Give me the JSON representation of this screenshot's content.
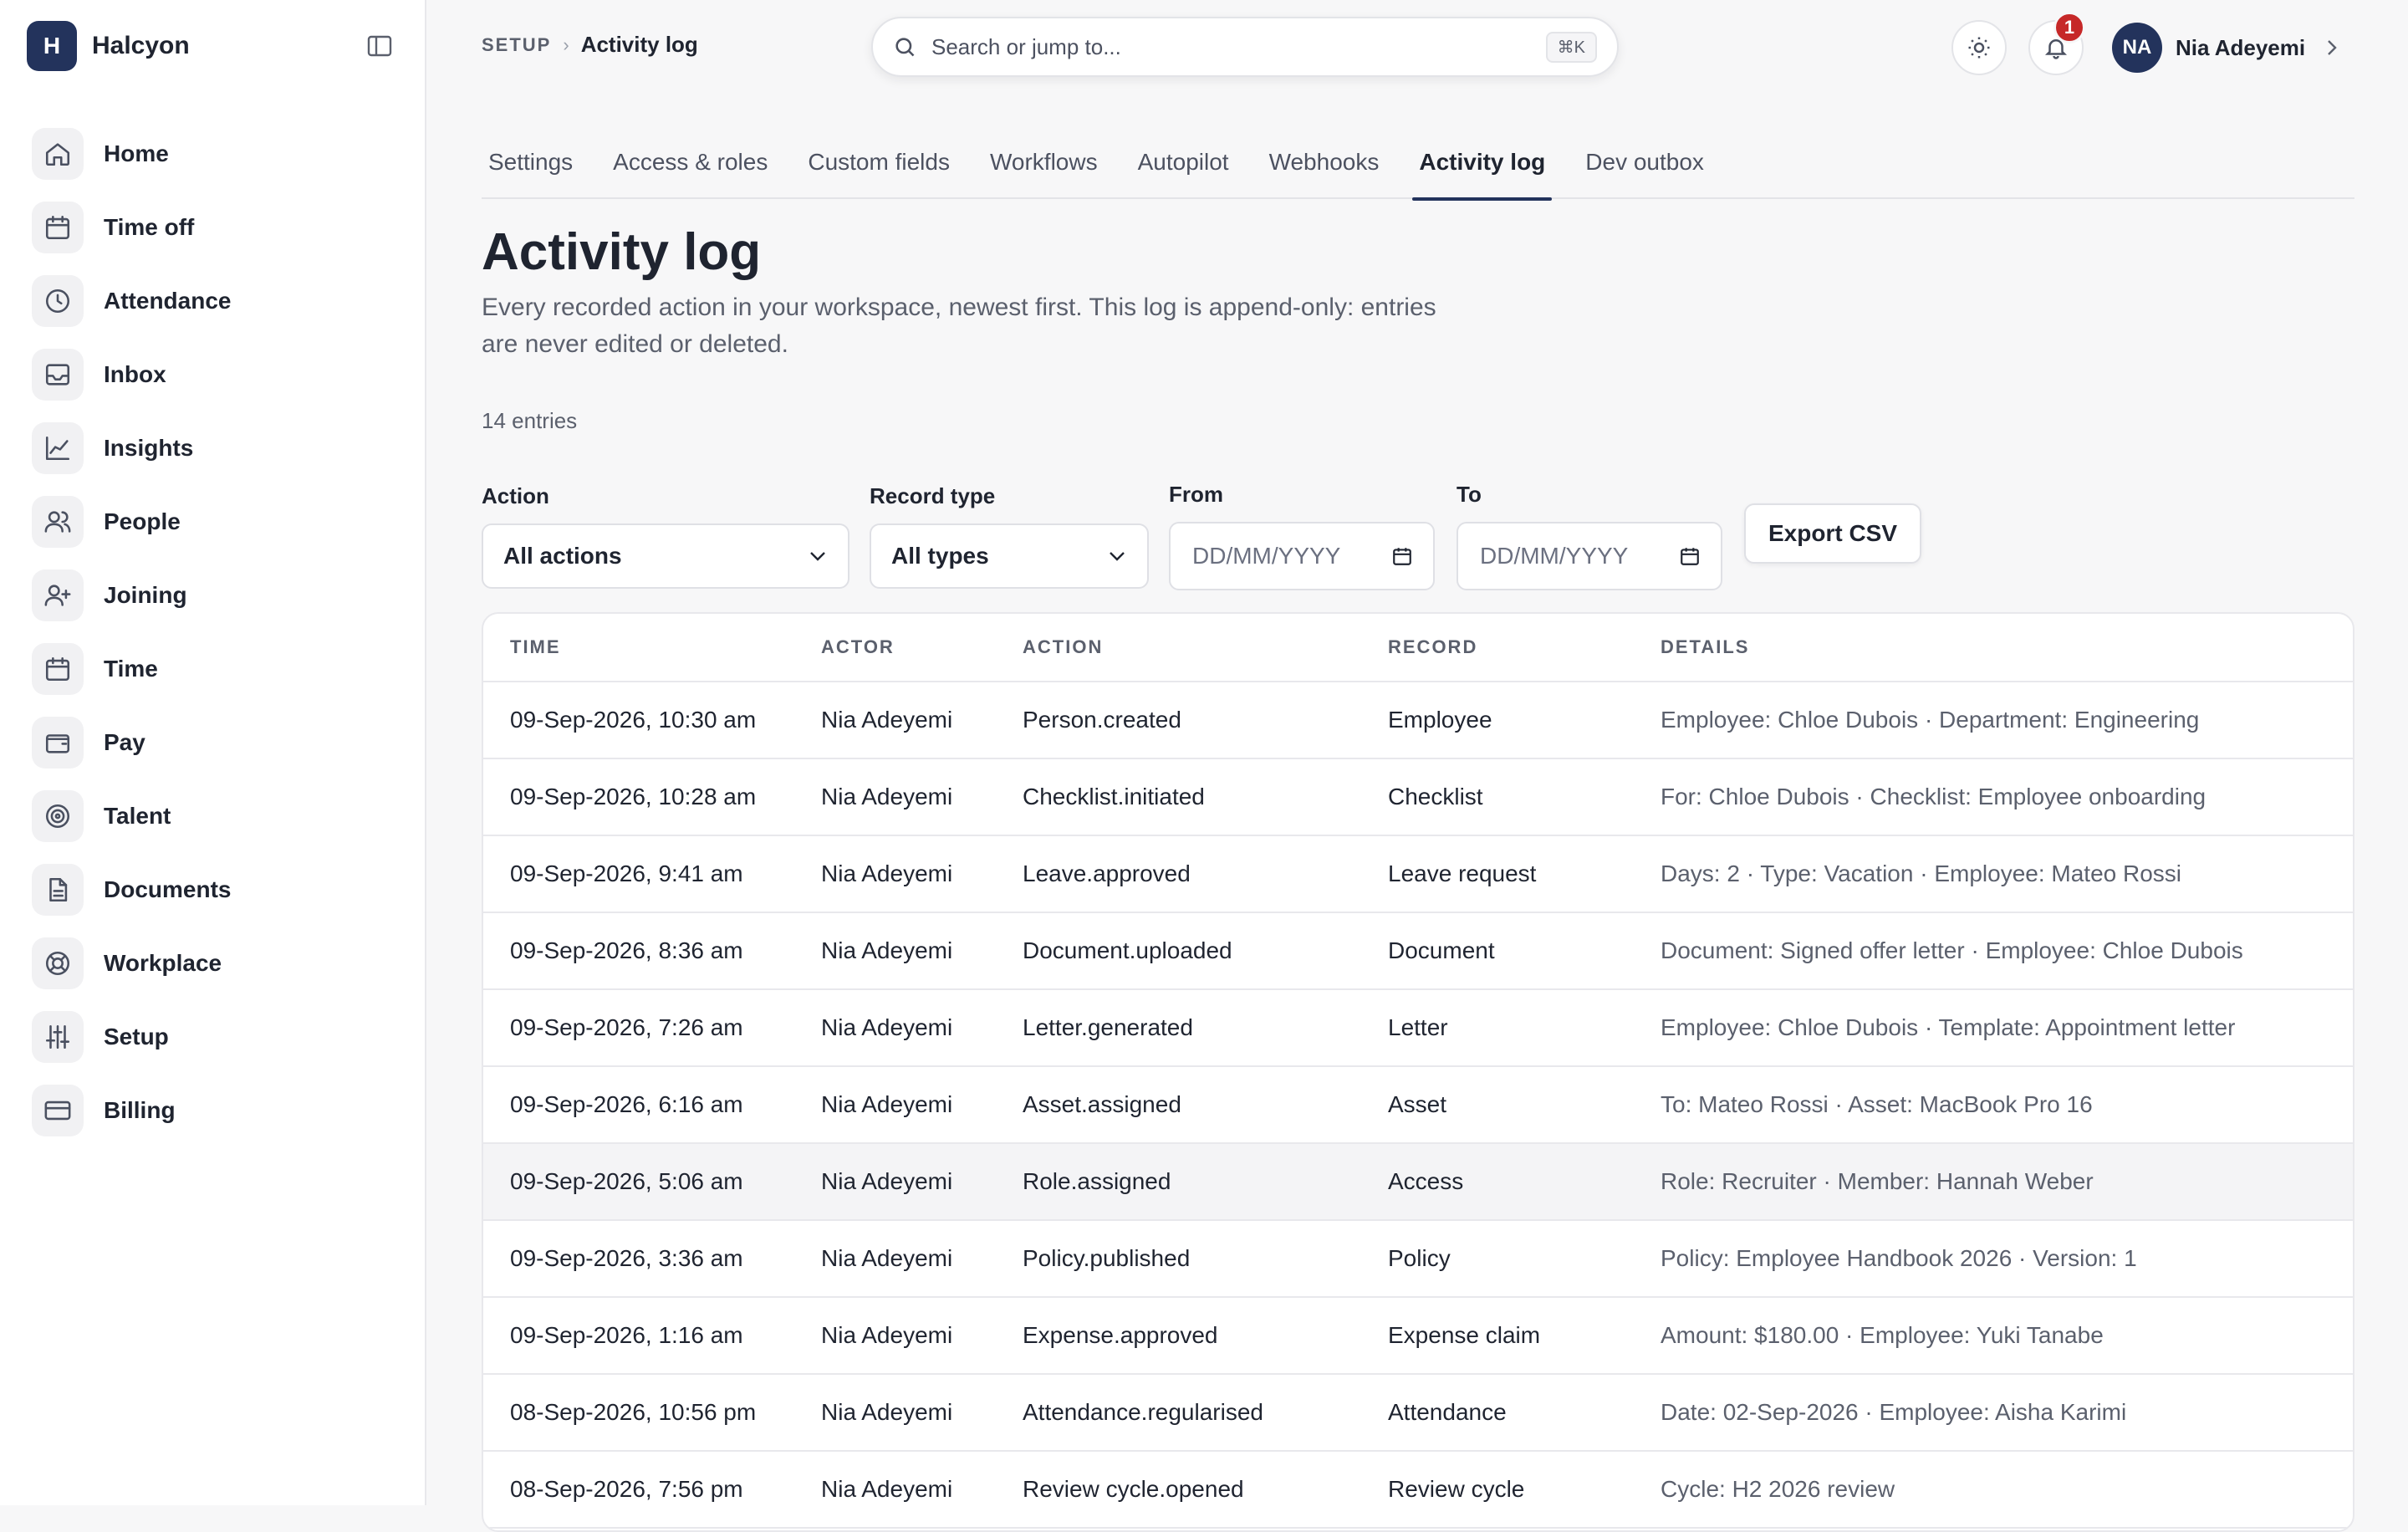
{
  "app": {
    "name": "Halcyon",
    "logo_letter": "H"
  },
  "sidebar": {
    "items": [
      {
        "label": "Home",
        "icon": "home-icon"
      },
      {
        "label": "Time off",
        "icon": "calendar-icon"
      },
      {
        "label": "Attendance",
        "icon": "clock-icon"
      },
      {
        "label": "Inbox",
        "icon": "inbox-icon"
      },
      {
        "label": "Insights",
        "icon": "chart-icon"
      },
      {
        "label": "People",
        "icon": "users-icon"
      },
      {
        "label": "Joining",
        "icon": "user-plus-icon"
      },
      {
        "label": "Time",
        "icon": "calendar-icon"
      },
      {
        "label": "Pay",
        "icon": "wallet-icon"
      },
      {
        "label": "Talent",
        "icon": "target-icon"
      },
      {
        "label": "Documents",
        "icon": "document-icon"
      },
      {
        "label": "Workplace",
        "icon": "lifebuoy-icon"
      },
      {
        "label": "Setup",
        "icon": "sliders-icon"
      },
      {
        "label": "Billing",
        "icon": "credit-card-icon"
      }
    ]
  },
  "breadcrumb": {
    "section": "SETUP",
    "current": "Activity log"
  },
  "search": {
    "placeholder": "Search or jump to...",
    "shortcut": "⌘K"
  },
  "header": {
    "notification_count": "1",
    "user_initials": "NA",
    "user_name": "Nia Adeyemi"
  },
  "tabs": [
    {
      "label": "Settings"
    },
    {
      "label": "Access & roles"
    },
    {
      "label": "Custom fields"
    },
    {
      "label": "Workflows"
    },
    {
      "label": "Autopilot"
    },
    {
      "label": "Webhooks"
    },
    {
      "label": "Activity log",
      "active": true
    },
    {
      "label": "Dev outbox"
    }
  ],
  "page": {
    "title": "Activity log",
    "subtitle": "Every recorded action in your workspace, newest first. This log is append-only: entries are never edited or deleted.",
    "entry_count": "14 entries"
  },
  "filters": {
    "action_label": "Action",
    "action_value": "All actions",
    "record_type_label": "Record type",
    "record_type_value": "All types",
    "from_label": "From",
    "from_placeholder": "DD/MM/YYYY",
    "to_label": "To",
    "to_placeholder": "DD/MM/YYYY",
    "export_label": "Export CSV"
  },
  "table": {
    "headers": {
      "time": "TIME",
      "actor": "ACTOR",
      "action": "ACTION",
      "record": "RECORD",
      "details": "DETAILS"
    },
    "rows": [
      {
        "time": "09-Sep-2026, 10:30 am",
        "actor": "Nia Adeyemi",
        "action": "Person.created",
        "record": "Employee",
        "details": "Employee: Chloe Dubois · Department: Engineering"
      },
      {
        "time": "09-Sep-2026, 10:28 am",
        "actor": "Nia Adeyemi",
        "action": "Checklist.initiated",
        "record": "Checklist",
        "details": "For: Chloe Dubois · Checklist: Employee onboarding"
      },
      {
        "time": "09-Sep-2026, 9:41 am",
        "actor": "Nia Adeyemi",
        "action": "Leave.approved",
        "record": "Leave request",
        "details": "Days: 2 · Type: Vacation · Employee: Mateo Rossi"
      },
      {
        "time": "09-Sep-2026, 8:36 am",
        "actor": "Nia Adeyemi",
        "action": "Document.uploaded",
        "record": "Document",
        "details": "Document: Signed offer letter · Employee: Chloe Dubois"
      },
      {
        "time": "09-Sep-2026, 7:26 am",
        "actor": "Nia Adeyemi",
        "action": "Letter.generated",
        "record": "Letter",
        "details": "Employee: Chloe Dubois · Template: Appointment letter"
      },
      {
        "time": "09-Sep-2026, 6:16 am",
        "actor": "Nia Adeyemi",
        "action": "Asset.assigned",
        "record": "Asset",
        "details": "To: Mateo Rossi · Asset: MacBook Pro 16"
      },
      {
        "time": "09-Sep-2026, 5:06 am",
        "actor": "Nia Adeyemi",
        "action": "Role.assigned",
        "record": "Access",
        "details": "Role: Recruiter · Member: Hannah Weber",
        "highlight": true
      },
      {
        "time": "09-Sep-2026, 3:36 am",
        "actor": "Nia Adeyemi",
        "action": "Policy.published",
        "record": "Policy",
        "details": "Policy: Employee Handbook 2026 · Version: 1"
      },
      {
        "time": "09-Sep-2026, 1:16 am",
        "actor": "Nia Adeyemi",
        "action": "Expense.approved",
        "record": "Expense claim",
        "details": "Amount: $180.00 · Employee: Yuki Tanabe"
      },
      {
        "time": "08-Sep-2026, 10:56 pm",
        "actor": "Nia Adeyemi",
        "action": "Attendance.regularised",
        "record": "Attendance",
        "details": "Date: 02-Sep-2026 · Employee: Aisha Karimi"
      },
      {
        "time": "08-Sep-2026, 7:56 pm",
        "actor": "Nia Adeyemi",
        "action": "Review cycle.opened",
        "record": "Review cycle",
        "details": "Cycle: H2 2026 review"
      }
    ]
  }
}
